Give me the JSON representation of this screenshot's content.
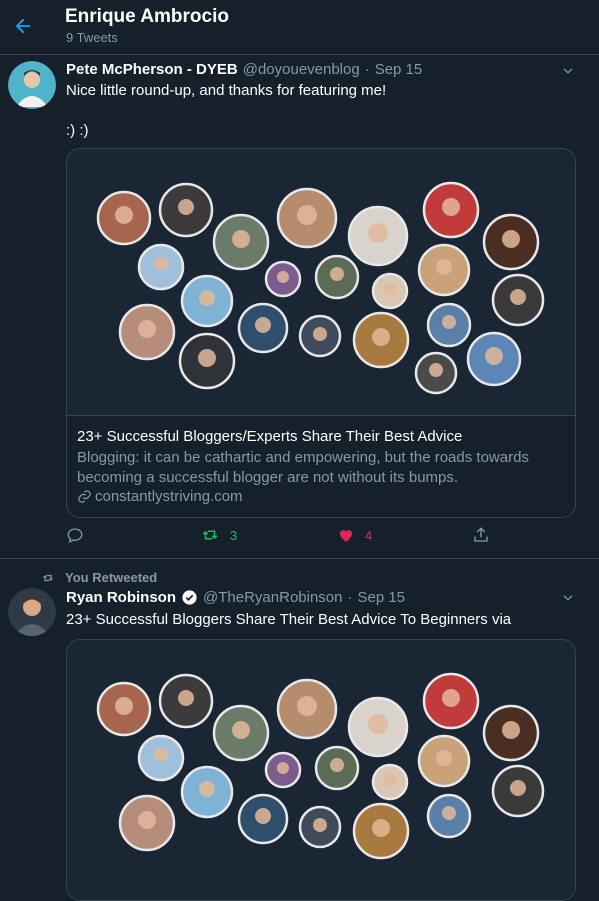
{
  "header": {
    "title": "Enrique Ambrocio",
    "subtitle": "9 Tweets"
  },
  "tweet1": {
    "name": "Pete McPherson - DYEB",
    "handle": "@doyouevenblog",
    "sep": "·",
    "date": "Sep 15",
    "text_line1": "Nice little round-up, and thanks for featuring me!",
    "text_line2": ":) :)",
    "card": {
      "title": "23+ Successful Bloggers/Experts Share Their Best Advice",
      "description": "Blogging: it can be cathartic and empowering, but the roads towards becoming a successful blogger are not without its bumps.",
      "domain": "constantlystriving.com"
    },
    "actions": {
      "retweet_count": "3",
      "like_count": "4"
    },
    "colors": {
      "retweet": "#17bf63",
      "like": "#e0245e",
      "muted": "#8899a6"
    }
  },
  "retweet_label": "You Retweeted",
  "tweet2": {
    "name": "Ryan Robinson",
    "handle": "@TheRyanRobinson",
    "sep": "·",
    "date": "Sep 15",
    "text": "23+ Successful Bloggers Share Their Best Advice To Beginners via"
  },
  "colors": {
    "background": "#15202b",
    "border": "#38444d",
    "accent": "#1da1f2"
  }
}
